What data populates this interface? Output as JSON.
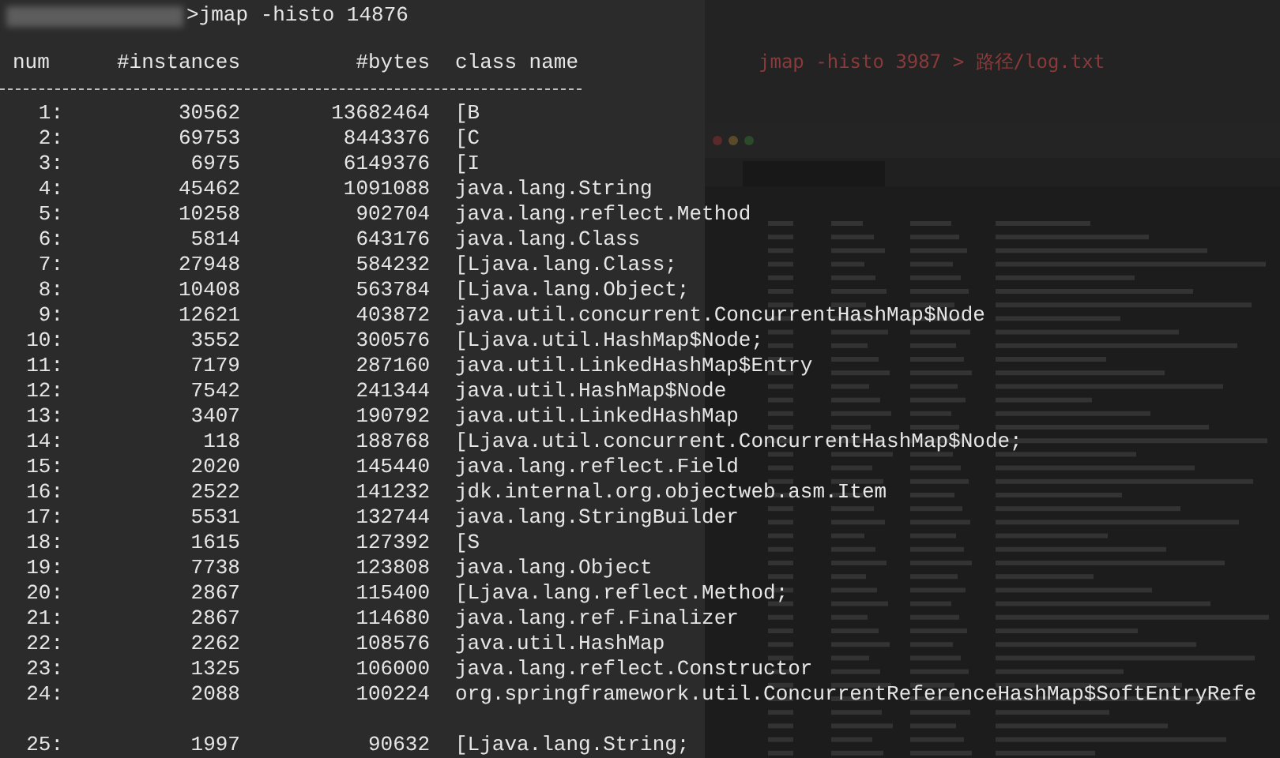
{
  "background_window": {
    "command": "jmap -histo 3987 > 路径/log.txt"
  },
  "terminal": {
    "prompt_symbol": ">",
    "command": "jmap -histo 14876"
  },
  "table": {
    "columns": [
      "num",
      "#instances",
      "#bytes",
      "class name"
    ],
    "rows": [
      [
        "1:",
        "30562",
        "13682464",
        "[B"
      ],
      [
        "2:",
        "69753",
        "8443376",
        "[C"
      ],
      [
        "3:",
        "6975",
        "6149376",
        "[I"
      ],
      [
        "4:",
        "45462",
        "1091088",
        "java.lang.String"
      ],
      [
        "5:",
        "10258",
        "902704",
        "java.lang.reflect.Method"
      ],
      [
        "6:",
        "5814",
        "643176",
        "java.lang.Class"
      ],
      [
        "7:",
        "27948",
        "584232",
        "[Ljava.lang.Class;"
      ],
      [
        "8:",
        "10408",
        "563784",
        "[Ljava.lang.Object;"
      ],
      [
        "9:",
        "12621",
        "403872",
        "java.util.concurrent.ConcurrentHashMap$Node"
      ],
      [
        "10:",
        "3552",
        "300576",
        "[Ljava.util.HashMap$Node;"
      ],
      [
        "11:",
        "7179",
        "287160",
        "java.util.LinkedHashMap$Entry"
      ],
      [
        "12:",
        "7542",
        "241344",
        "java.util.HashMap$Node"
      ],
      [
        "13:",
        "3407",
        "190792",
        "java.util.LinkedHashMap"
      ],
      [
        "14:",
        "118",
        "188768",
        "[Ljava.util.concurrent.ConcurrentHashMap$Node;"
      ],
      [
        "15:",
        "2020",
        "145440",
        "java.lang.reflect.Field"
      ],
      [
        "16:",
        "2522",
        "141232",
        "jdk.internal.org.objectweb.asm.Item"
      ],
      [
        "17:",
        "5531",
        "132744",
        "java.lang.StringBuilder"
      ],
      [
        "18:",
        "1615",
        "127392",
        "[S"
      ],
      [
        "19:",
        "7738",
        "123808",
        "java.lang.Object"
      ],
      [
        "20:",
        "2867",
        "115400",
        "[Ljava.lang.reflect.Method;"
      ],
      [
        "21:",
        "2867",
        "114680",
        "java.lang.ref.Finalizer"
      ],
      [
        "22:",
        "2262",
        "108576",
        "java.util.HashMap"
      ],
      [
        "23:",
        "1325",
        "106000",
        "java.lang.reflect.Constructor"
      ],
      [
        "24:",
        "2088",
        "100224",
        "org.springframework.util.ConcurrentReferenceHashMap$SoftEntryRefe"
      ],
      [
        "25:",
        "1997",
        "90632",
        "[Ljava.lang.String;"
      ]
    ]
  }
}
